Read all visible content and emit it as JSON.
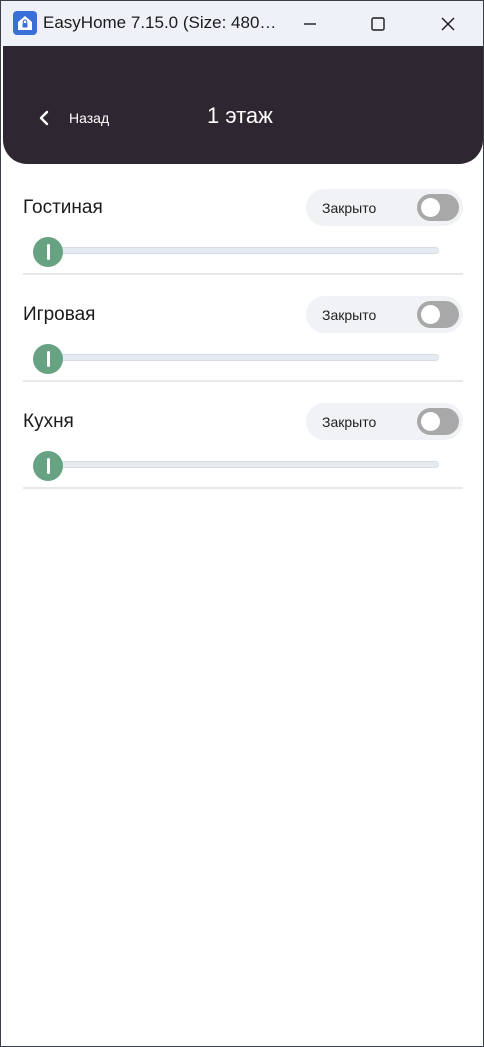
{
  "window": {
    "title": "EasyHome 7.15.0 (Size: 480…",
    "icon": "home-lock-icon"
  },
  "header": {
    "back_label": "Назад",
    "title": "1 этаж",
    "background_color": "#2e2630"
  },
  "rooms": [
    {
      "name": "Гостиная",
      "status": "Закрыто",
      "toggle_on": false,
      "level": 0
    },
    {
      "name": "Игровая",
      "status": "Закрыто",
      "toggle_on": false,
      "level": 0
    },
    {
      "name": "Кухня",
      "status": "Закрыто",
      "toggle_on": false,
      "level": 0
    }
  ],
  "colors": {
    "accent": "#67a283",
    "toggle_off": "#a8a8a8"
  }
}
